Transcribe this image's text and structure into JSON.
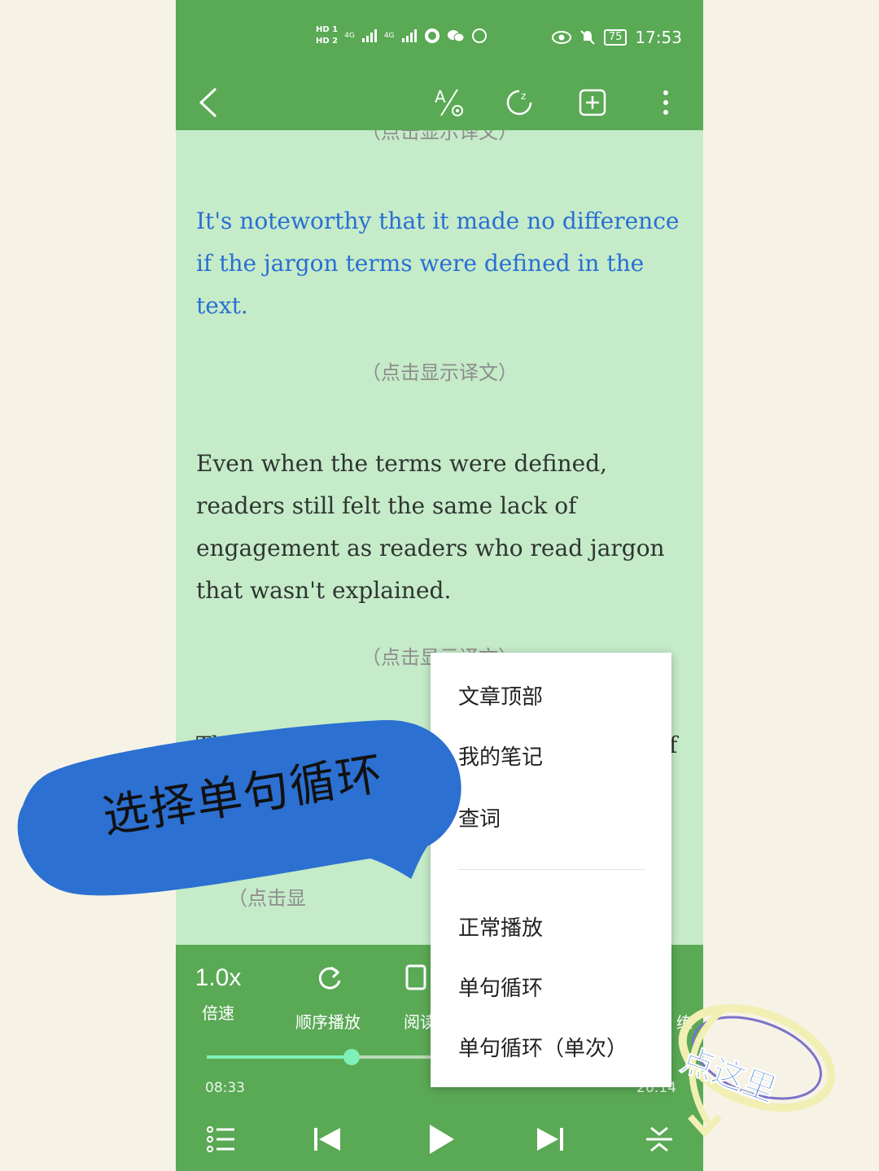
{
  "status_bar": {
    "hd1": "HD 1",
    "hd2": "HD 2",
    "net1": "4G",
    "net2": "4G",
    "battery": "75",
    "time": "17:53"
  },
  "toolbar": {
    "icons": [
      "back-icon",
      "translate-icon",
      "sleep-timer-icon",
      "add-icon",
      "more-icon"
    ]
  },
  "content": {
    "hint_top_partial": "（点击显示译文）",
    "para1": "It's noteworthy that it made no difference if the jargon terms were defined in the text.",
    "hint1": "（点击显示译文）",
    "para2": "Even when the terms were defined, readers still felt the same lack of engagement as readers who read jargon that wasn't explained.",
    "hint2": "（点击显示译文）",
    "para3_partial": "Th",
    "para3_right_partial": "f",
    "hint3": "（点击显"
  },
  "player": {
    "speed_value": "1.0x",
    "speed_label": "倍速",
    "order_label": "顺序播放",
    "read_label": "阅读",
    "right_label_partial": "练",
    "progress_fraction": 0.33,
    "time_elapsed": "08:33",
    "time_total_partial": "26:14"
  },
  "context_menu": {
    "items_top": [
      "文章顶部",
      "我的笔记",
      "查词"
    ],
    "items_bottom": [
      "正常播放",
      "单句循环",
      "单句循环（单次）"
    ]
  },
  "annotations": {
    "bubble_text": "选择单句循环",
    "sticker_text": "点这里"
  },
  "colors": {
    "bar_green": "#5aa955",
    "content_bg": "#c5ebc8",
    "bubble_blue": "#2c70d1",
    "accent_progress": "#7ef0b8"
  }
}
